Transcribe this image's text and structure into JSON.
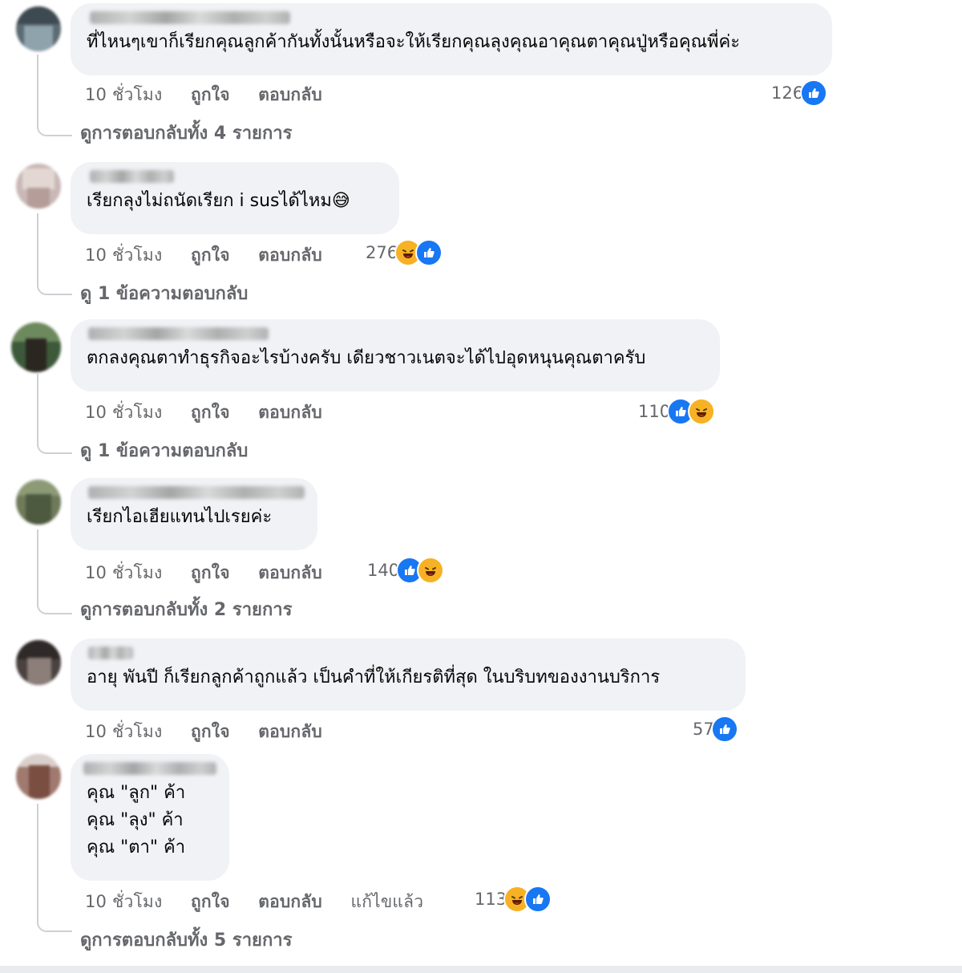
{
  "comments": [
    {
      "text": "ที่ไหนๆเขาก็เรียกคุณลูกค้ากันทั้งนั้นหรือจะให้เรียกคุณลุงคุณอาคุณตาคุณปู่หรือคุณพี่ค่ะ",
      "time": "10 ชั่วโมง",
      "like_label": "ถูกใจ",
      "reply_label": "ตอบกลับ",
      "reaction_count": "126",
      "reactions": [
        "like-icon"
      ],
      "replies_link": "ดูการตอบกลับทั้ง 4 รายการ"
    },
    {
      "text": "เรียกลุงไม่ถนัดเรียก i susได้ไหม😅",
      "time": "10 ชั่วโมง",
      "like_label": "ถูกใจ",
      "reply_label": "ตอบกลับ",
      "reaction_count": "276",
      "reactions": [
        "haha-icon",
        "like-icon"
      ],
      "replies_link": "ดู 1 ข้อความตอบกลับ"
    },
    {
      "text": "ตกลงคุณตาทำธุรกิจอะไรบ้างครับ เดียวชาวเนตจะได้ไปอุดหนุนคุณตาครับ",
      "time": "10 ชั่วโมง",
      "like_label": "ถูกใจ",
      "reply_label": "ตอบกลับ",
      "reaction_count": "110",
      "reactions": [
        "like-icon",
        "haha-icon"
      ],
      "replies_link": "ดู 1 ข้อความตอบกลับ"
    },
    {
      "text": "เรียกไอเฮียแทนไปเรยค่ะ",
      "time": "10 ชั่วโมง",
      "like_label": "ถูกใจ",
      "reply_label": "ตอบกลับ",
      "reaction_count": "140",
      "reactions": [
        "like-icon",
        "haha-icon"
      ],
      "replies_link": "ดูการตอบกลับทั้ง 2 รายการ"
    },
    {
      "text": "อายุ พันปี ก็เรียกลูกค้าถูกแล้ว เป็นคำที่ให้เกียรติที่สุด ในบริบทของงานบริการ",
      "time": "10 ชั่วโมง",
      "like_label": "ถูกใจ",
      "reply_label": "ตอบกลับ",
      "reaction_count": "57",
      "reactions": [
        "like-icon"
      ],
      "replies_link": ""
    },
    {
      "text": "คุณ \"ลูก\" ค้า\nคุณ \"ลุง\" ค้า\nคุณ \"ตา\" ค้า",
      "time": "10 ชั่วโมง",
      "like_label": "ถูกใจ",
      "reply_label": "ตอบกลับ",
      "edited_label": "แก้ไขแล้ว",
      "reaction_count": "113",
      "reactions": [
        "haha-icon",
        "like-icon"
      ],
      "replies_link": "ดูการตอบกลับทั้ง 5 รายการ"
    }
  ],
  "colors": {
    "bubble": "#f0f2f5",
    "meta_text": "#65676b",
    "like": "#1877f2",
    "haha": "#f7b125"
  }
}
